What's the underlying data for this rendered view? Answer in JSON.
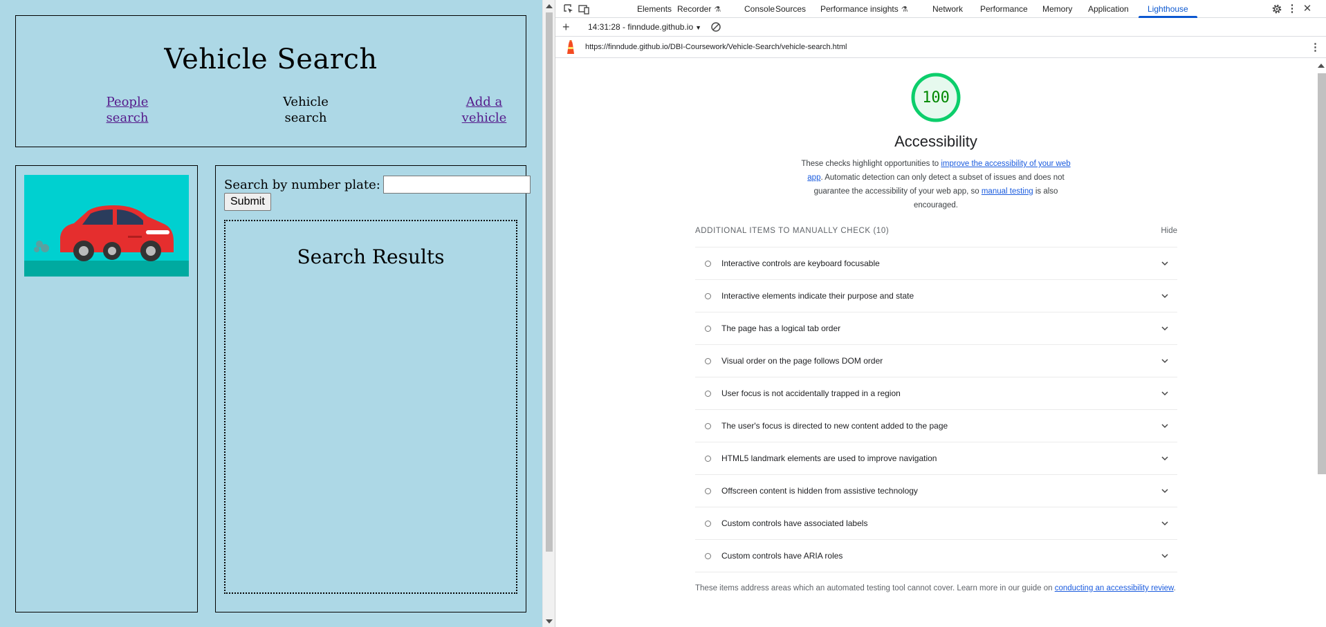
{
  "site": {
    "title": "Vehicle Search",
    "nav": [
      {
        "label": "People search",
        "link": true
      },
      {
        "label": "Vehicle search",
        "link": false
      },
      {
        "label": "Add a vehicle",
        "link": true
      }
    ],
    "search_label": "Search by number plate:",
    "search_value": "",
    "submit_label": "Submit",
    "results_title": "Search Results",
    "colors": {
      "background": "#add8e6",
      "car_body": "#e52e2e",
      "image_sky": "#00d0d0",
      "link": "#551a8b"
    }
  },
  "devtools": {
    "tabs": [
      "Elements",
      "Recorder",
      "Console",
      "Sources",
      "Performance insights",
      "Network",
      "Performance",
      "Memory",
      "Application",
      "Lighthouse"
    ],
    "experimental_tabs": [
      "Recorder",
      "Performance insights"
    ],
    "active_tab": "Lighthouse",
    "icons": [
      "inspect-icon",
      "device-toggle-icon",
      "settings-icon",
      "more-vert-icon",
      "close-icon"
    ],
    "report_selector": "14:31:28 - finndude.github.io",
    "url": "https://finndude.github.io/DBI-Coursework/Vehicle-Search/vehicle-search.html"
  },
  "report": {
    "score": "100",
    "category": "Accessibility",
    "description": {
      "part1": "These checks highlight opportunities to ",
      "link1": "improve the accessibility of your web app",
      "part2": ". Automatic detection can only detect a subset of issues and does not guarantee the accessibility of your web app, so ",
      "link2": "manual testing",
      "part3": " is also encouraged."
    },
    "manual_title": "Additional items to manually check (10)",
    "hide_label": "Hide",
    "manual_items": [
      "Interactive controls are keyboard focusable",
      "Interactive elements indicate their purpose and state",
      "The page has a logical tab order",
      "Visual order on the page follows DOM order",
      "User focus is not accidentally trapped in a region",
      "The user's focus is directed to new content added to the page",
      "HTML5 landmark elements are used to improve navigation",
      "Offscreen content is hidden from assistive technology",
      "Custom controls have associated labels",
      "Custom controls have ARIA roles"
    ],
    "footer": {
      "text": "These items address areas which an automated testing tool cannot cover. Learn more in our guide on ",
      "link": "conducting an accessibility review",
      "end": "."
    },
    "colors": {
      "pass": "#0cce6b",
      "score_text": "#008800",
      "link": "#1a5bde",
      "accent": "#0b57d0"
    }
  }
}
